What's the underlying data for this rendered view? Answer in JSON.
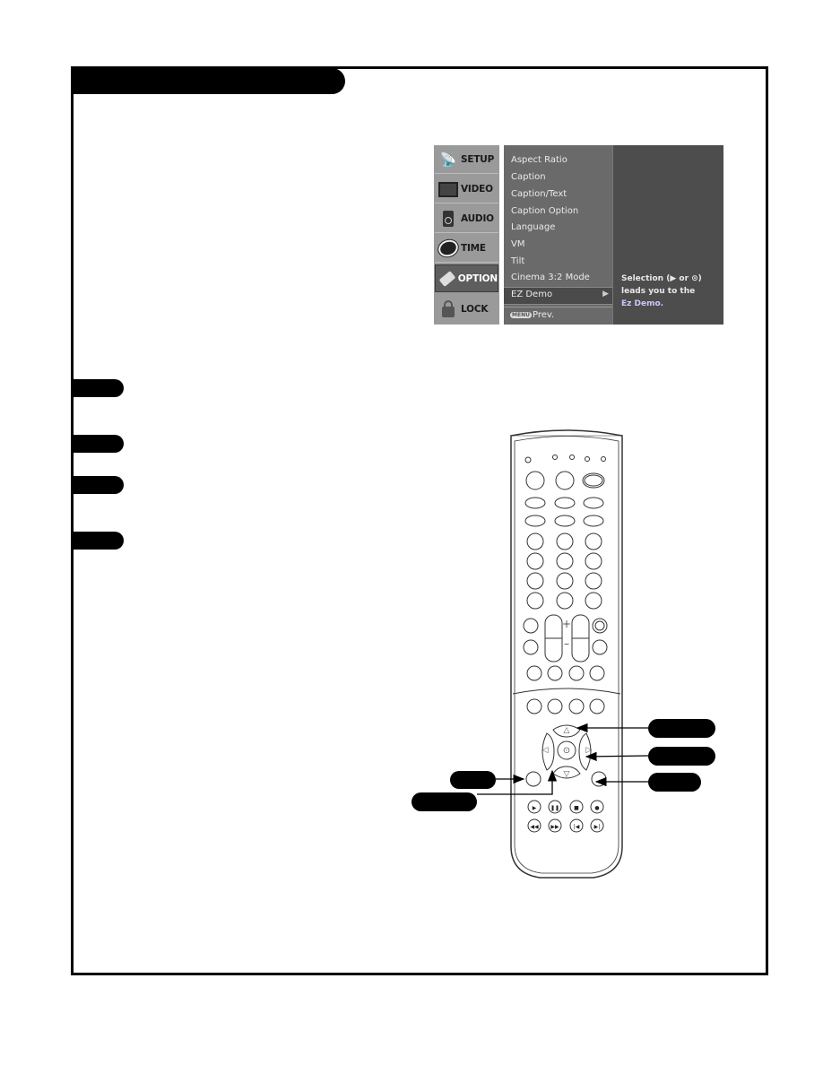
{
  "page": {
    "title_bar": "",
    "step_tabs": [
      "",
      "",
      "",
      ""
    ]
  },
  "osd_menu": {
    "categories": [
      {
        "label": "SETUP",
        "icon": "satellite-icon",
        "active": false
      },
      {
        "label": "VIDEO",
        "icon": "tv-icon",
        "active": false
      },
      {
        "label": "AUDIO",
        "icon": "speaker-icon",
        "active": false
      },
      {
        "label": "TIME",
        "icon": "clock-icon",
        "active": false
      },
      {
        "label": "OPTION",
        "icon": "tag-icon",
        "active": true
      },
      {
        "label": "LOCK",
        "icon": "padlock-icon",
        "active": false
      }
    ],
    "items": [
      "Aspect Ratio",
      "Caption",
      "Caption/Text",
      "Caption Option",
      "Language",
      "VM",
      "Tilt",
      "Cinema 3:2 Mode",
      "EZ Demo"
    ],
    "selected_item": "EZ Demo",
    "selected_arrow": "▶",
    "prev_button_badge": "MENU",
    "prev_button_label": "Prev.",
    "help_line1": "Selection (▶ or ⊙)",
    "help_line2": "leads you to the",
    "help_line3": "Ez Demo."
  },
  "remote": {
    "plus_label": "+",
    "minus_label": "–",
    "up_glyph": "△",
    "down_glyph": "▽",
    "left_glyph": "◁",
    "right_glyph": "▷",
    "enter_glyph": "⊙",
    "transport": [
      "▶",
      "❚❚",
      "■",
      "●",
      "◀◀",
      "▶▶",
      "|◀",
      "▶|"
    ]
  },
  "callouts": {
    "up_label": "",
    "right_label": "",
    "exit_label": "",
    "menu_label": "",
    "down_label": ""
  }
}
